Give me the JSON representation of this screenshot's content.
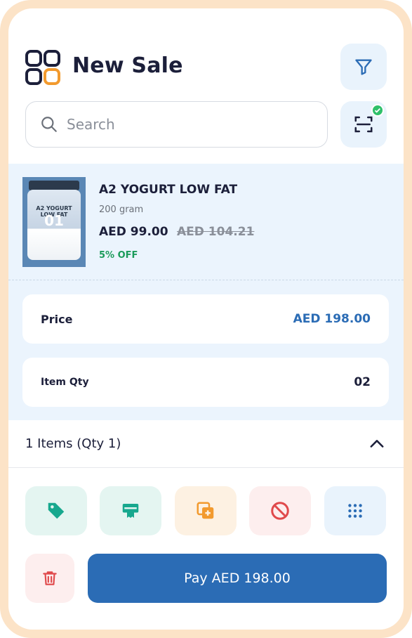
{
  "header": {
    "title": "New Sale"
  },
  "search": {
    "placeholder": "Search"
  },
  "product": {
    "name": "A2 YOGURT LOW FAT",
    "weight": "200 gram",
    "price": "AED 99.00",
    "old_price": "AED 104.21",
    "discount": "5% OFF",
    "thumb_label": "A2 YOGURT LOW FAT",
    "thumb_badge": "01"
  },
  "summary": {
    "price_label": "Price",
    "price_value": "AED 198.00",
    "qty_label": "Item Qty",
    "qty_value": "02"
  },
  "items_bar": {
    "text": "1 Items (Qty 1)"
  },
  "actions": [
    {
      "icon": "tag-icon",
      "bg": "#e4f5f1",
      "color": "#17a88e"
    },
    {
      "icon": "receipt-icon",
      "bg": "#e4f5f1",
      "color": "#17a88e"
    },
    {
      "icon": "add-copy-icon",
      "bg": "#fdf1e2",
      "color": "#f29a2e"
    },
    {
      "icon": "block-icon",
      "bg": "#fdeeee",
      "color": "#e0494b"
    },
    {
      "icon": "grid-dots-icon",
      "bg": "#e9f3fc",
      "color": "#2b6cb5"
    }
  ],
  "pay": {
    "label": "Pay AED 198.00"
  },
  "colors": {
    "accent": "#2b6cb5",
    "frame": "#fce3c7",
    "panel": "#ebf4fd",
    "success": "#2fc06a"
  }
}
